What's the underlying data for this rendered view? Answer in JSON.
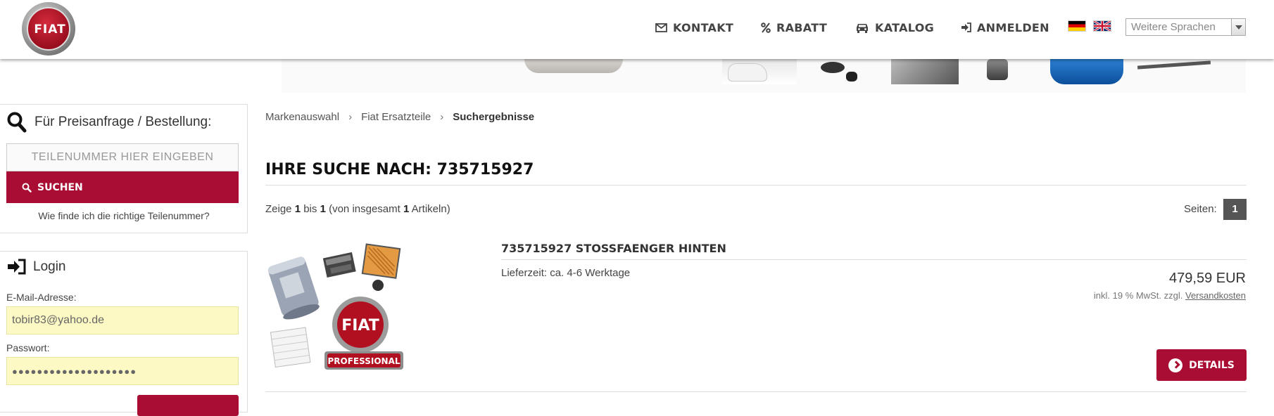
{
  "header": {
    "logo_text": "FIAT",
    "nav": [
      {
        "label": "KONTAKT",
        "icon": "envelope-icon"
      },
      {
        "label": "RABATT",
        "icon": "percent-icon"
      },
      {
        "label": "KATALOG",
        "icon": "car-icon"
      },
      {
        "label": "ANMELDEN",
        "icon": "sign-in-icon"
      }
    ],
    "flags": [
      "flag-de-icon",
      "flag-uk-icon"
    ],
    "language_select": "Weitere Sprachen"
  },
  "sidebar": {
    "search_title": "Für Preisanfrage / Bestellung:",
    "part_input_placeholder": "TEILENUMMER HIER EINGEBEN",
    "search_button": "SUCHEN",
    "help_link": "Wie finde ich die richtige Teilenummer?",
    "login_title": "Login",
    "email_label": "E-Mail-Adresse:",
    "email_value": "tobir83@yahoo.de",
    "password_label": "Passwort:",
    "password_value": "●●●●●●●●●●●●●●●●●●●●"
  },
  "breadcrumb": [
    "Markenauswahl",
    "Fiat Ersatzteile",
    "Suchergebnisse"
  ],
  "main": {
    "title": "IHRE SUCHE NACH: 735715927",
    "result_prefix": "Zeige",
    "result_from": "1",
    "result_mid": "bis",
    "result_to": "1",
    "result_suffix1": "(von insgesamt",
    "result_total": "1",
    "result_suffix2": "Artikeln)",
    "pages_label": "Seiten:",
    "page_current": "1"
  },
  "product": {
    "title": "735715927 STOSSFAENGER HINTEN",
    "delivery": "Lieferzeit: ca. 4-6 Werktage",
    "price": "479,59 EUR",
    "tax_text": "inkl. 19 % MwSt. zzgl.",
    "shipping_link": "Versandkosten",
    "details_button": "DETAILS",
    "image_badge": "FIAT",
    "image_banner": "PROFESSIONAL"
  },
  "colors": {
    "accent": "#a90d33",
    "input_highlight": "#fdf9c4",
    "page_badge": "#555555"
  }
}
